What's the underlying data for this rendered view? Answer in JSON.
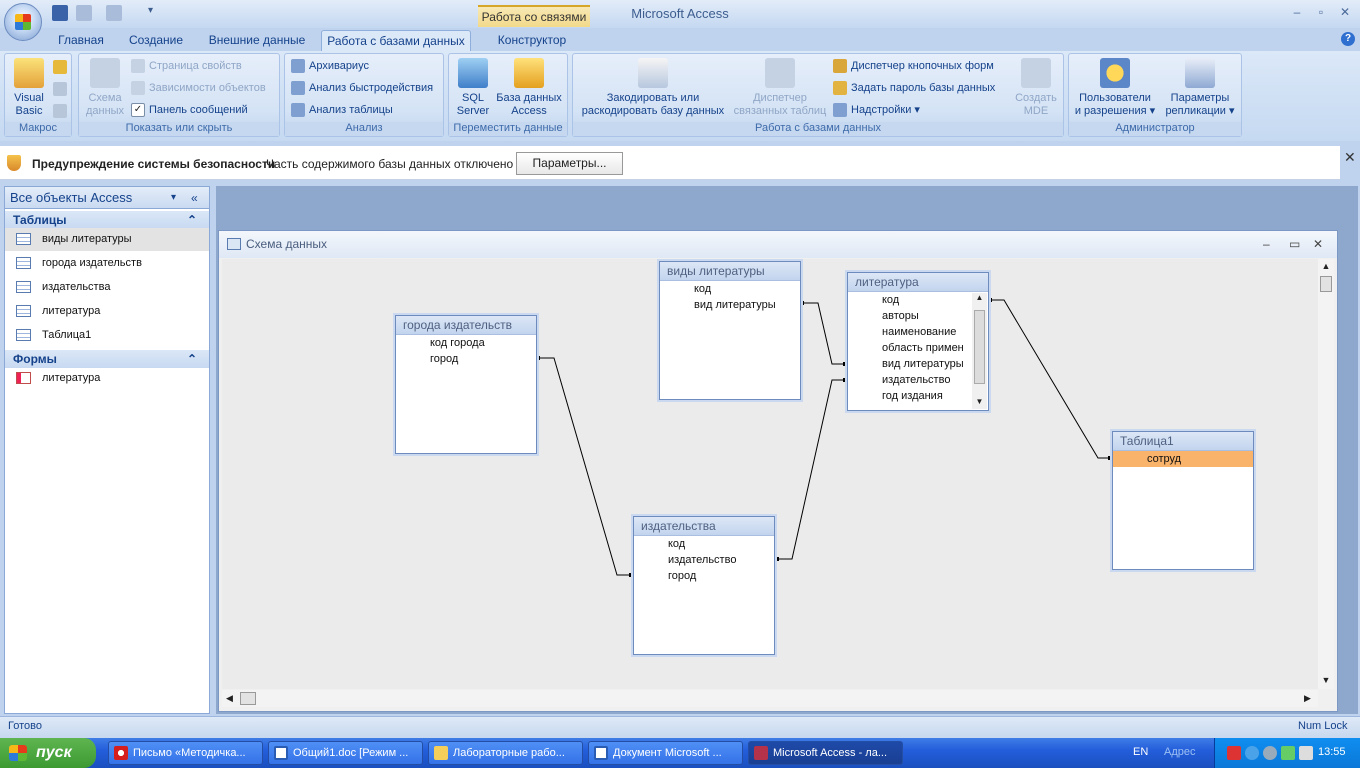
{
  "app_title": "Microsoft Access",
  "context_group": "Работа со связями",
  "tabs": [
    "Главная",
    "Создание",
    "Внешние данные",
    "Работа с базами данных",
    "Конструктор"
  ],
  "ribbon": {
    "macro": {
      "label": "Макрос",
      "vb1": "Visual",
      "vb2": "Basic"
    },
    "show_hide": {
      "label": "Показать или скрыть",
      "schema1": "Схема",
      "schema2": "данных",
      "props": "Страница свойств",
      "deps": "Зависимости объектов",
      "msgbar": "Панель сообщений"
    },
    "analysis": {
      "label": "Анализ",
      "archivist": "Архивариус",
      "perf": "Анализ быстродействия",
      "table": "Анализ таблицы"
    },
    "move": {
      "label": "Переместить данные",
      "sql1": "SQL",
      "sql2": "Server",
      "acc1": "База данных",
      "acc2": "Access"
    },
    "db": {
      "label": "Работа с базами данных",
      "encode1": "Закодировать или",
      "encode2": "раскодировать базу данных",
      "linked1": "Диспетчер",
      "linked2": "связанных таблиц",
      "switchboard": "Диспетчер кнопочных форм",
      "password": "Задать пароль базы данных",
      "addins": "Надстройки",
      "mde1": "Создать",
      "mde2": "MDE"
    },
    "admin": {
      "label": "Администратор",
      "users1": "Пользователи",
      "users2": "и разрешения",
      "repl1": "Параметры",
      "repl2": "репликации"
    }
  },
  "message_bar": {
    "title": "Предупреждение системы безопасности",
    "text": "Часть содержимого базы данных отключено",
    "button": "Параметры..."
  },
  "nav": {
    "header": "Все объекты Access",
    "tables_header": "Таблицы",
    "tables": [
      "виды литературы",
      "города издательств",
      "издательства",
      "литература",
      "Таблица1"
    ],
    "forms_header": "Формы",
    "forms": [
      "литература"
    ]
  },
  "schema_window": {
    "title": "Схема данных"
  },
  "tables": {
    "vidy": {
      "title": "виды литературы",
      "fields": [
        "код",
        "вид литературы"
      ]
    },
    "lit": {
      "title": "литература",
      "fields": [
        "код",
        "авторы",
        "наименование",
        "область примен",
        "вид литературы",
        "издательство",
        "год издания"
      ]
    },
    "goroda": {
      "title": "города издательств",
      "fields": [
        "код города",
        "город"
      ]
    },
    "izd": {
      "title": "издательства",
      "fields": [
        "код",
        "издательство",
        "город"
      ]
    },
    "t1": {
      "title": "Таблица1",
      "fields": [
        "сотруд"
      ]
    }
  },
  "status": {
    "left": "Готово",
    "right": "Num Lock"
  },
  "taskbar": {
    "start": "пуск",
    "items": [
      "Письмо «Методичка...",
      "Общий1.doc [Режим ...",
      "Лабораторные рабо...",
      "Документ Microsoft ...",
      "Microsoft Access - ла..."
    ],
    "lang": "EN",
    "address": "Адрес",
    "clock": "13:55"
  }
}
